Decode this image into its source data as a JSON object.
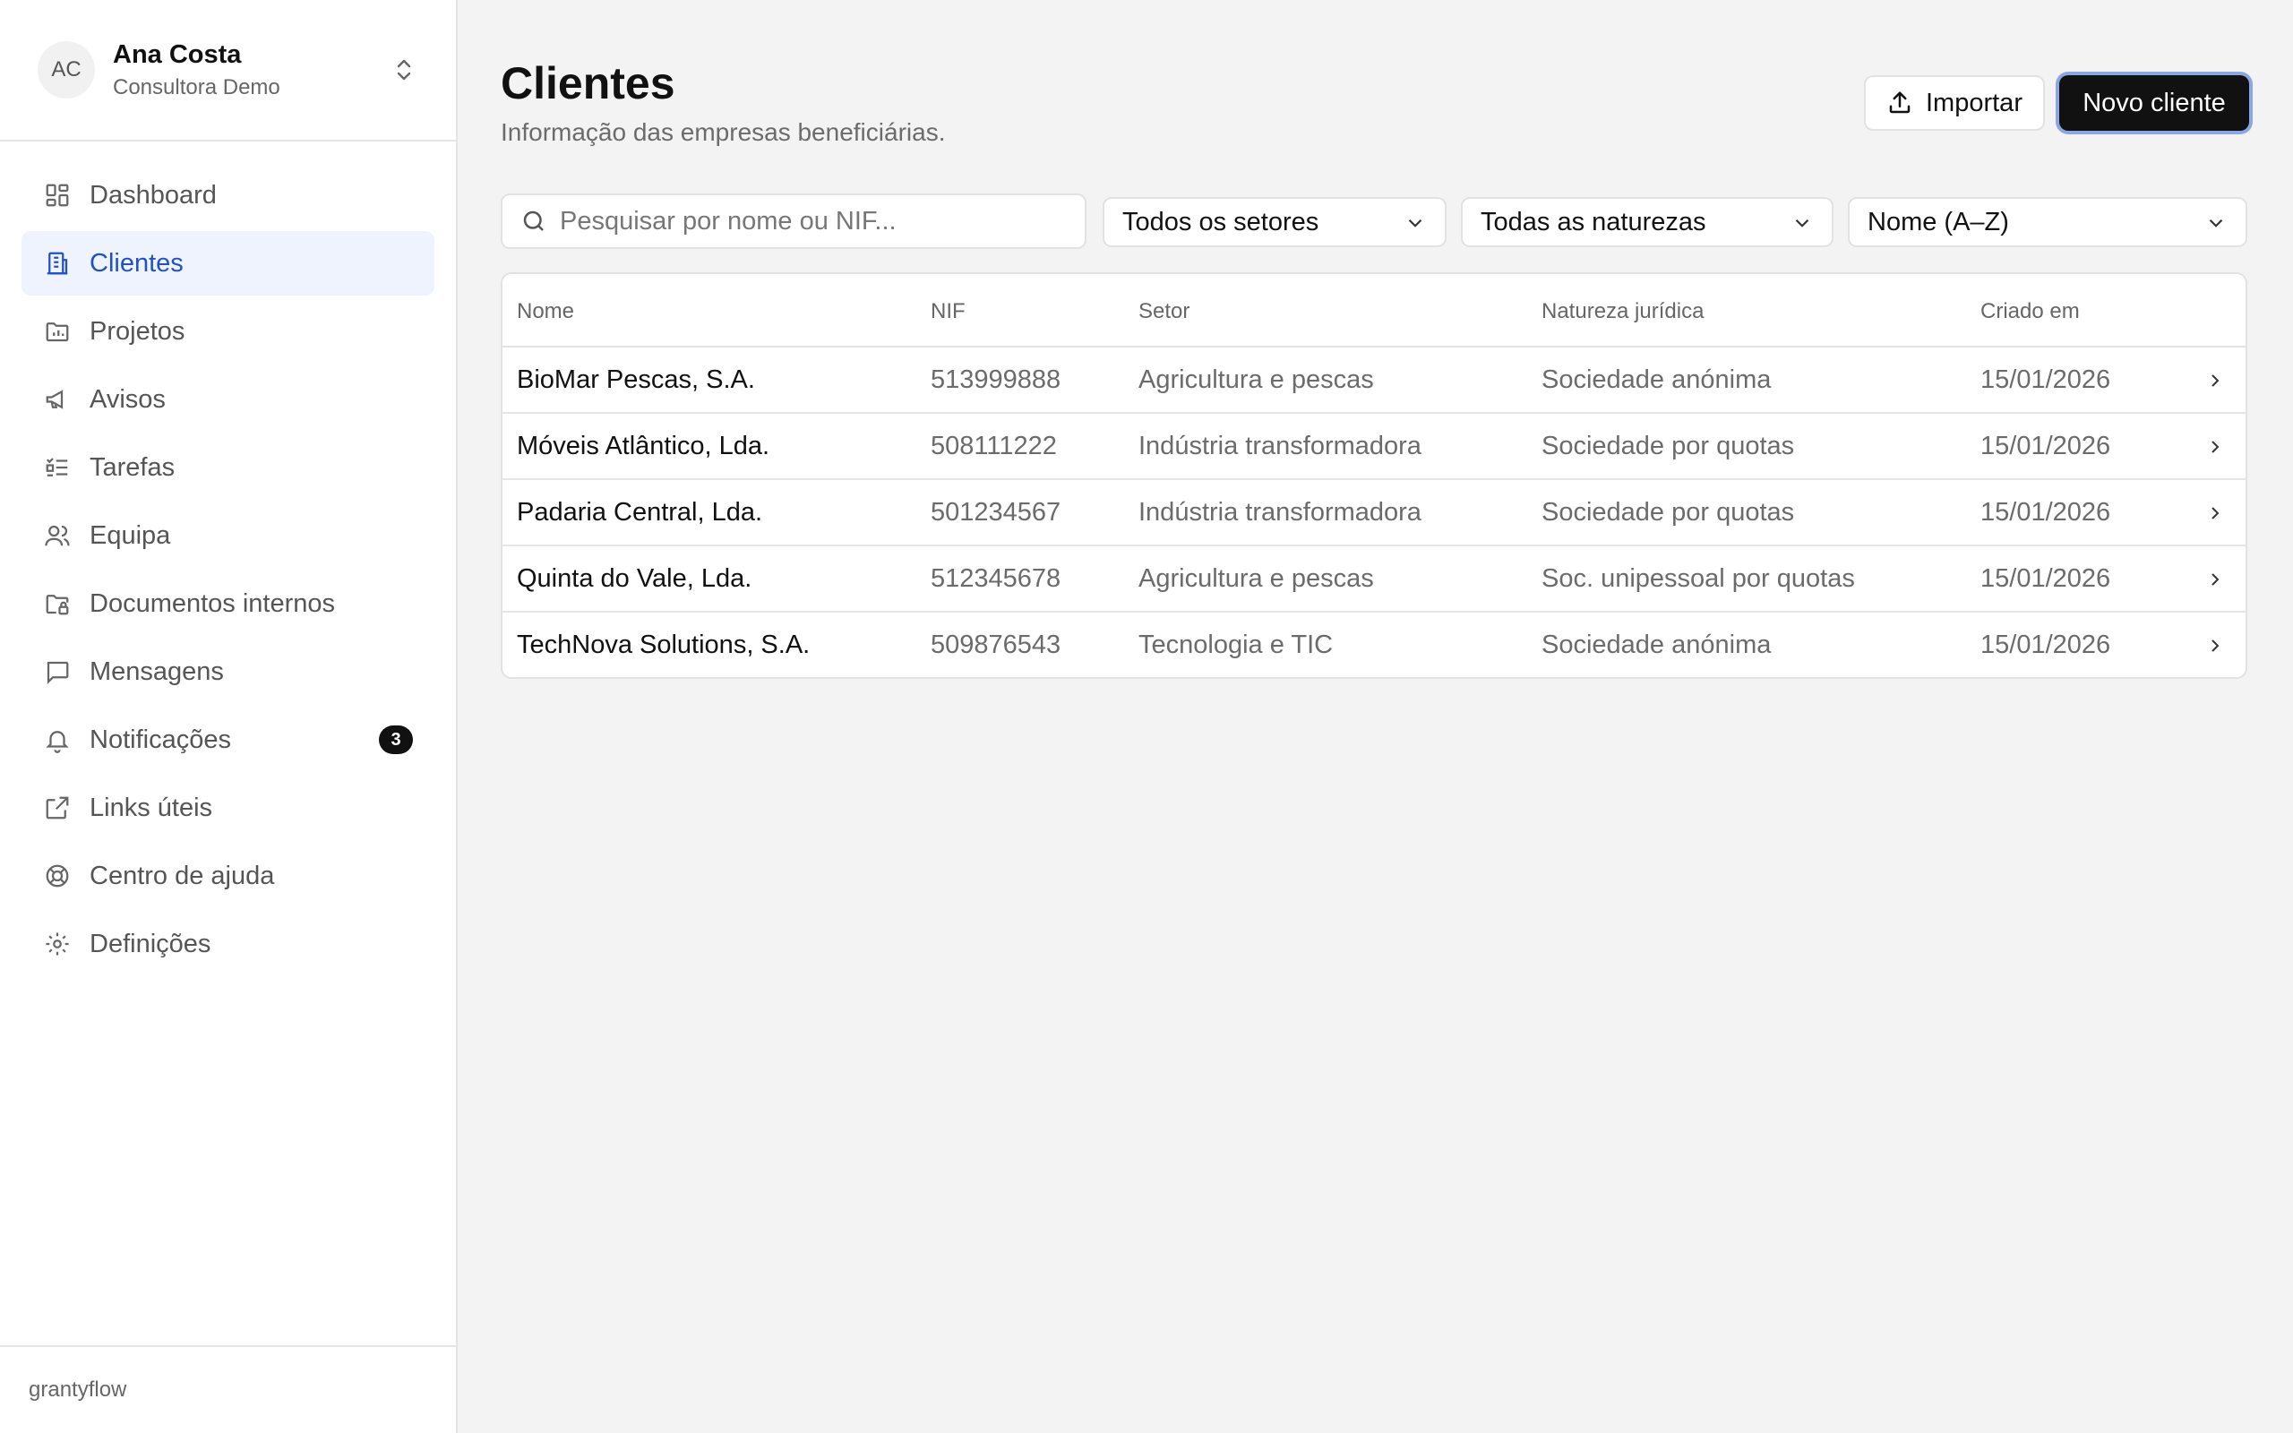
{
  "account": {
    "initials": "AC",
    "name": "Ana Costa",
    "role": "Consultora Demo"
  },
  "sidebar": {
    "items": [
      {
        "label": "Dashboard",
        "icon": "dashboard-icon"
      },
      {
        "label": "Clientes",
        "icon": "building-icon",
        "active": true
      },
      {
        "label": "Projetos",
        "icon": "folder-chart-icon"
      },
      {
        "label": "Avisos",
        "icon": "megaphone-icon"
      },
      {
        "label": "Tarefas",
        "icon": "checklist-icon"
      },
      {
        "label": "Equipa",
        "icon": "users-icon"
      },
      {
        "label": "Documentos internos",
        "icon": "folder-lock-icon"
      },
      {
        "label": "Mensagens",
        "icon": "message-icon"
      },
      {
        "label": "Notificações",
        "icon": "bell-icon",
        "badge": "3"
      },
      {
        "label": "Links úteis",
        "icon": "external-link-icon"
      },
      {
        "label": "Centro de ajuda",
        "icon": "lifebuoy-icon"
      },
      {
        "label": "Definições",
        "icon": "gear-icon"
      }
    ],
    "footer": "grantyflow"
  },
  "page": {
    "title": "Clientes",
    "subtitle": "Informação das empresas beneficiárias.",
    "import_label": "Importar",
    "new_label": "Novo cliente"
  },
  "filters": {
    "search_placeholder": "Pesquisar por nome ou NIF...",
    "sector": "Todos os setores",
    "nature": "Todas as naturezas",
    "sort": "Nome (A–Z)"
  },
  "table": {
    "headers": [
      "Nome",
      "NIF",
      "Setor",
      "Natureza jurídica",
      "Criado em"
    ],
    "rows": [
      [
        "BioMar Pescas, S.A.",
        "513999888",
        "Agricultura e pescas",
        "Sociedade anónima",
        "15/01/2026"
      ],
      [
        "Móveis Atlântico, Lda.",
        "508111222",
        "Indústria transformadora",
        "Sociedade por quotas",
        "15/01/2026"
      ],
      [
        "Padaria Central, Lda.",
        "501234567",
        "Indústria transformadora",
        "Sociedade por quotas",
        "15/01/2026"
      ],
      [
        "Quinta do Vale, Lda.",
        "512345678",
        "Agricultura e pescas",
        "Soc. unipessoal por quotas",
        "15/01/2026"
      ],
      [
        "TechNova Solutions, S.A.",
        "509876543",
        "Tecnologia e TIC",
        "Sociedade anónima",
        "15/01/2026"
      ]
    ]
  },
  "colors": {
    "accent": "#2150c9",
    "active_bg": "#eef3fd",
    "primary_button": "#111111",
    "focus_ring": "#8aa7e4"
  }
}
